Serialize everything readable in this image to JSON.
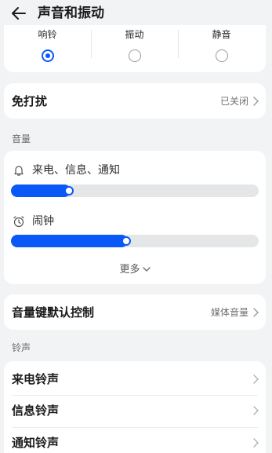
{
  "header": {
    "title": "声音和振动",
    "back_icon": "arrow-left-icon"
  },
  "modes": [
    {
      "label": "响铃",
      "selected": true
    },
    {
      "label": "振动",
      "selected": false
    },
    {
      "label": "静音",
      "selected": false
    }
  ],
  "dnd": {
    "label": "免打扰",
    "value": "已关闭"
  },
  "volume_section": {
    "label": "音量",
    "sliders": [
      {
        "label": "来电、信息、通知",
        "icon": "bell-icon",
        "level": 0.24
      },
      {
        "label": "闹钟",
        "icon": "alarm-clock-icon",
        "level": 0.47
      }
    ],
    "more_label": "更多"
  },
  "volume_key": {
    "label": "音量键默认控制",
    "value": "媒体音量"
  },
  "ringtone_section": {
    "label": "铃声",
    "items": [
      {
        "label": "来电铃声"
      },
      {
        "label": "信息铃声"
      },
      {
        "label": "通知铃声"
      }
    ]
  },
  "colors": {
    "accent": "#0a59f7",
    "background": "#f1f3f5",
    "card": "#ffffff"
  }
}
